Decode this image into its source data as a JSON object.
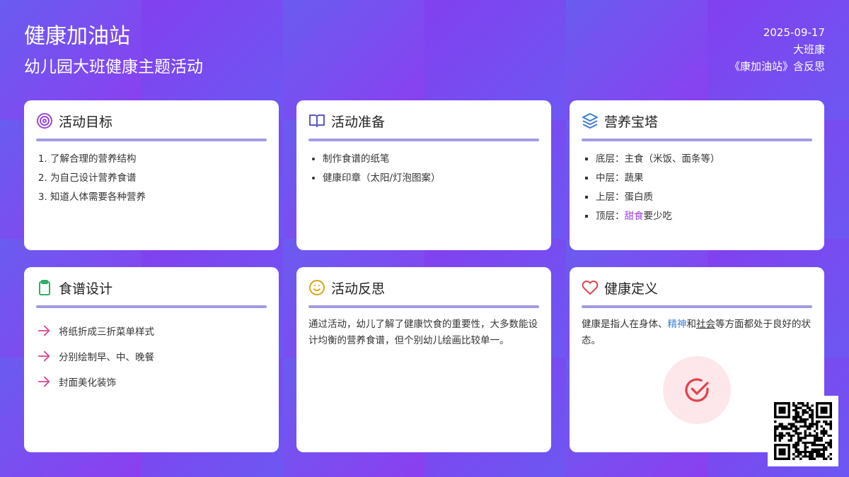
{
  "header": {
    "title": "健康加油站",
    "subtitle": "幼儿园大班健康主题活动",
    "date": "2025-09-17",
    "class_name": "大班康",
    "doc_name": "《康加油站》含反思"
  },
  "cards": {
    "goals": {
      "title": "活动目标",
      "icon": "target-icon",
      "items": [
        "了解合理的营养结构",
        "为自己设计营养食谱",
        "知道人体需要各种营养"
      ]
    },
    "prep": {
      "title": "活动准备",
      "icon": "book-icon",
      "items": [
        "制作食谱的纸笔",
        "健康印章（太阳/灯泡图案）"
      ]
    },
    "pyramid": {
      "title": "营养宝塔",
      "icon": "layers-icon",
      "items": [
        "底层：主食（米饭、面条等）",
        "中层：蔬果",
        "上层：蛋白质"
      ],
      "last_prefix": "顶层：",
      "last_highlight": "甜食",
      "last_suffix": "要少吃"
    },
    "recipe": {
      "title": "食谱设计",
      "icon": "clipboard-icon",
      "items": [
        "将纸折成三折菜单样式",
        "分别绘制早、中、晚餐",
        "封面美化装饰"
      ]
    },
    "reflection": {
      "title": "活动反思",
      "icon": "smile-icon",
      "text": "通过活动，幼儿了解了健康饮食的重要性，大多数能设计均衡的营养食谱，但个别幼儿绘画比较单一。"
    },
    "definition": {
      "title": "健康定义",
      "icon": "heart-icon",
      "text_1": "健康是指人在身体、",
      "text_highlight_1": "精神",
      "text_2": "和",
      "text_highlight_2": "社会",
      "text_3": "等方面都处于良好的状态。",
      "badge_icon": "check-circle-icon"
    }
  },
  "colors": {
    "accent_purple": "#9d3de0",
    "arrow_pink": "#d9468f",
    "heart_red": "#e0454f",
    "divider": "#a19be3"
  }
}
